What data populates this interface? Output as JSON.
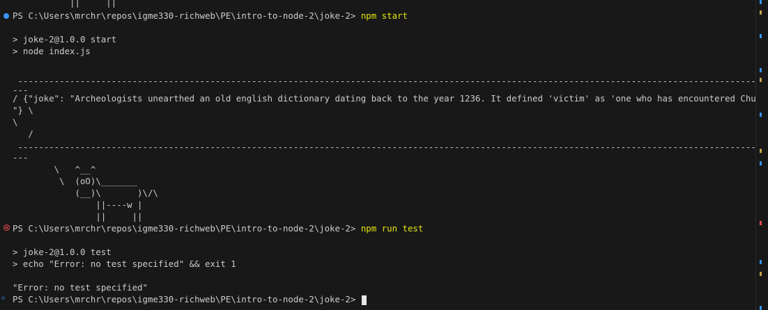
{
  "terminal": {
    "top_cut": "           ||     ||",
    "prompt1": "PS C:\\Users\\mrchr\\repos\\igme330-richweb\\PE\\intro-to-node-2\\joke-2> ",
    "cmd1": "npm start",
    "start_l1": "> joke-2@1.0.0 start",
    "start_l2": "> node index.js",
    "dash1": " ------------------------------------------------------------------------------------------------------------------------------------------------------",
    "dash1b": "---",
    "joke_l1": "/ {\"joke\": \"Archeologists unearthed an old english dictionary dating back to the year 1236. It defined 'victim' as 'one who has encountered Chuck Norris'",
    "joke_l2": "\"} \\",
    "joke_l3": "\\",
    "joke_l4": "   /",
    "dash2": " ------------------------------------------------------------------------------------------------------------------------------------------------------",
    "dash2b": "---",
    "cow_l1": "        \\   ^__^",
    "cow_l2": "         \\  (oO)\\_______",
    "cow_l3": "            (__)\\       )\\/\\",
    "cow_l4": "                ||----w |",
    "cow_l5": "                ||     ||",
    "prompt2": "PS C:\\Users\\mrchr\\repos\\igme330-richweb\\PE\\intro-to-node-2\\joke-2> ",
    "cmd2": "npm run test",
    "test_l1": "> joke-2@1.0.0 test",
    "test_l2": "> echo \"Error: no test specified\" && exit 1",
    "error_out": "\"Error: no test specified\"",
    "prompt3": "PS C:\\Users\\mrchr\\repos\\igme330-richweb\\PE\\intro-to-node-2\\joke-2> "
  },
  "colors": {
    "background": "#181818",
    "text": "#cccccc",
    "command": "#e5e510",
    "success_marker": "#3794ff",
    "error_marker": "#f14c4c"
  }
}
